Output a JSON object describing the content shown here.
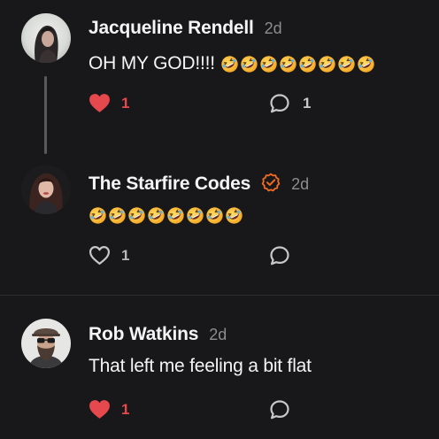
{
  "colors": {
    "background": "#18181a",
    "like_active": "#e5484d",
    "verified": "#f26b21",
    "muted": "#8d8d90"
  },
  "comments": [
    {
      "author": "Jacqueline Rendell",
      "time": "2d",
      "text": "OH MY GOD!!!!",
      "emoji_icon": "rolling-laughing-emoji",
      "emoji_count": 8,
      "liked": true,
      "likes": "1",
      "replies": "1",
      "verified": false
    },
    {
      "author": "The Starfire Codes",
      "time": "2d",
      "text": "",
      "emoji_icon": "rolling-laughing-emoji",
      "emoji_count": 8,
      "liked": false,
      "likes": "1",
      "replies": "",
      "verified": true,
      "verified_icon": "verified-check-icon"
    },
    {
      "author": "Rob Watkins",
      "time": "2d",
      "text": "That left me feeling a bit flat",
      "emoji_count": 0,
      "liked": true,
      "likes": "1",
      "replies": "",
      "verified": false
    }
  ],
  "icons": {
    "like": "heart-icon",
    "reply": "speech-bubble-icon"
  }
}
